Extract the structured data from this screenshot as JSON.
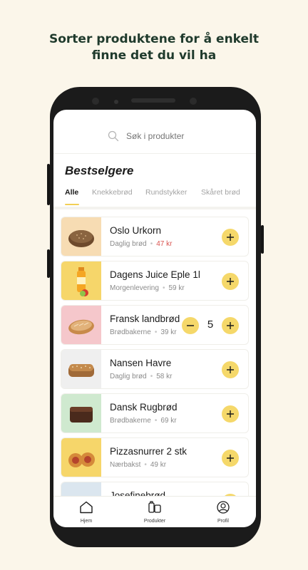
{
  "headline": {
    "line1": "Sorter produktene for å enkelt",
    "line2": "finne det du vil ha"
  },
  "search": {
    "placeholder": "Søk i produkter",
    "icon": "search-icon"
  },
  "section_title": "Bestselgere",
  "tabs": [
    {
      "label": "Alle",
      "active": true
    },
    {
      "label": "Knekkebrød",
      "active": false
    },
    {
      "label": "Rundstykker",
      "active": false
    },
    {
      "label": "Skåret brød",
      "active": false
    }
  ],
  "products": [
    {
      "name": "Oslo Urkorn",
      "category": "Daglig brød",
      "price": "47 kr",
      "price_color": "#d9534f",
      "thumb_bg": "#f7dcb3",
      "quantity": null
    },
    {
      "name": "Dagens Juice Eple 1l",
      "category": "Morgenlevering",
      "price": "59 kr",
      "thumb_bg": "#f6d66a",
      "quantity": null
    },
    {
      "name": "Fransk landbrød",
      "category": "Brødbakerne",
      "price": "39 kr",
      "thumb_bg": "#f5c7cb",
      "quantity": "5"
    },
    {
      "name": "Nansen Havre",
      "category": "Daglig brød",
      "price": "58 kr",
      "thumb_bg": "#efefef",
      "quantity": null
    },
    {
      "name": "Dansk Rugbrød",
      "category": "Brødbakerne",
      "price": "69 kr",
      "thumb_bg": "#cfe9cf",
      "quantity": null
    },
    {
      "name": "Pizzasnurrer 2 stk",
      "category": "Nærbakst",
      "price": "49 kr",
      "thumb_bg": "#f6d66a",
      "quantity": null
    },
    {
      "name": "Josefinebrød",
      "category": "",
      "price": "",
      "thumb_bg": "#dbe6ef",
      "quantity": null
    }
  ],
  "bottom_nav": [
    {
      "label": "Hjem",
      "icon": "home-icon"
    },
    {
      "label": "Produkter",
      "icon": "products-icon"
    },
    {
      "label": "Profil",
      "icon": "profile-icon"
    }
  ],
  "colors": {
    "accent": "#f5d86a",
    "background": "#fbf6ea",
    "headline": "#1f3a2c"
  }
}
